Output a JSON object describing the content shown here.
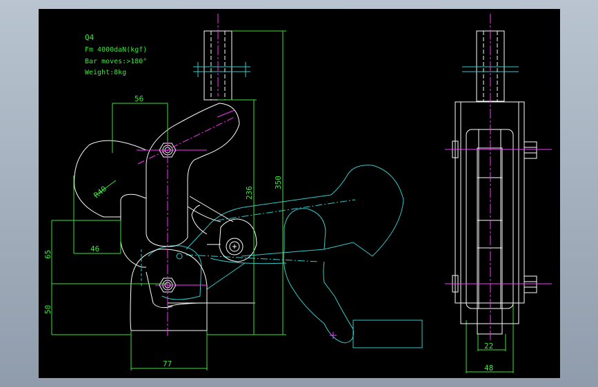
{
  "notes": {
    "title": "Q4",
    "force": "Fm 4000daN(kgf)",
    "bar": "Bar moves:>180°",
    "weight": "Weight:8kg"
  },
  "dimensions": {
    "d56": "56",
    "r40": "R40",
    "d46": "46",
    "d65": "65",
    "d50": "50",
    "d236": "236",
    "d350": "350",
    "d77": "77",
    "d22": "22",
    "d48": "48"
  },
  "colors": {
    "background": "#000000",
    "outline": "#ffffff",
    "dimension": "#39e639",
    "centerline": "#ff33ff",
    "phantom": "#33cccc"
  }
}
